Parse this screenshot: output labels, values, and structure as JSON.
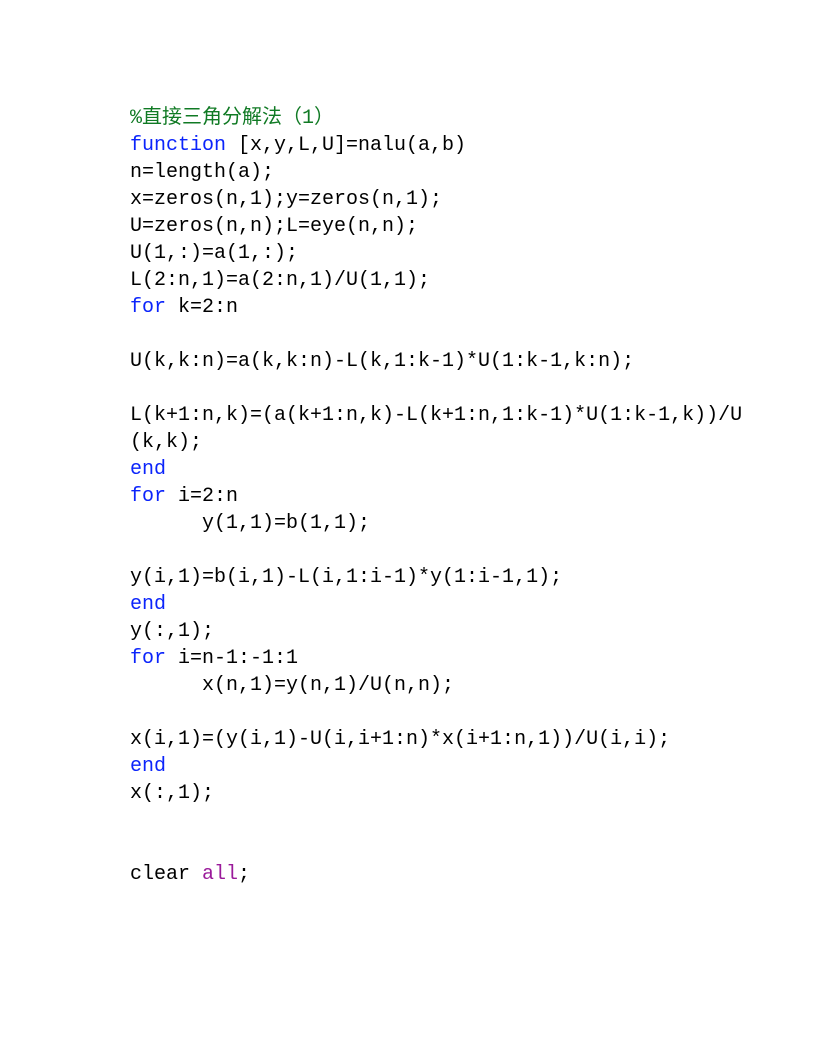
{
  "code": {
    "lines": [
      {
        "segments": [
          {
            "text": "%直接三角分解法（1）",
            "cls": "cmt"
          }
        ]
      },
      {
        "segments": [
          {
            "text": "function",
            "cls": "kw"
          },
          {
            "text": " [x,y,L,U]=nalu(a,b)",
            "cls": "blk"
          }
        ]
      },
      {
        "segments": [
          {
            "text": "n=length(a);",
            "cls": "blk"
          }
        ]
      },
      {
        "segments": [
          {
            "text": "x=zeros(n,1);y=zeros(n,1);",
            "cls": "blk"
          }
        ]
      },
      {
        "segments": [
          {
            "text": "U=zeros(n,n);L=eye(n,n);",
            "cls": "blk"
          }
        ]
      },
      {
        "segments": [
          {
            "text": "U(1,:)=a(1,:);",
            "cls": "blk"
          }
        ]
      },
      {
        "segments": [
          {
            "text": "L(2:n,1)=a(2:n,1)/U(1,1);",
            "cls": "blk"
          }
        ]
      },
      {
        "segments": [
          {
            "text": "for",
            "cls": "kw"
          },
          {
            "text": " k=2:n",
            "cls": "blk"
          }
        ]
      },
      {
        "segments": [
          {
            "text": "",
            "cls": "blk"
          }
        ]
      },
      {
        "segments": [
          {
            "text": "U(k,k:n)=a(k,k:n)-L(k,1:k-1)*U(1:k-1,k:n);",
            "cls": "blk"
          }
        ]
      },
      {
        "segments": [
          {
            "text": "",
            "cls": "blk"
          }
        ]
      },
      {
        "segments": [
          {
            "text": "L(k+1:n,k)=(a(k+1:n,k)-L(k+1:n,1:k-1)*U(1:k-1,k))/U(k,k);",
            "cls": "blk"
          }
        ]
      },
      {
        "segments": [
          {
            "text": "end",
            "cls": "kw"
          }
        ]
      },
      {
        "segments": [
          {
            "text": "for",
            "cls": "kw"
          },
          {
            "text": " i=2:n",
            "cls": "blk"
          }
        ]
      },
      {
        "segments": [
          {
            "text": "      y(1,1)=b(1,1);",
            "cls": "blk"
          }
        ]
      },
      {
        "segments": [
          {
            "text": "",
            "cls": "blk"
          }
        ]
      },
      {
        "segments": [
          {
            "text": "y(i,1)=b(i,1)-L(i,1:i-1)*y(1:i-1,1);",
            "cls": "blk"
          }
        ]
      },
      {
        "segments": [
          {
            "text": "end",
            "cls": "kw"
          }
        ]
      },
      {
        "segments": [
          {
            "text": "y(:,1);",
            "cls": "blk"
          }
        ]
      },
      {
        "segments": [
          {
            "text": "for",
            "cls": "kw"
          },
          {
            "text": " i=n-1:-1:1",
            "cls": "blk"
          }
        ]
      },
      {
        "segments": [
          {
            "text": "      x(n,1)=y(n,1)/U(n,n);",
            "cls": "blk"
          }
        ]
      },
      {
        "segments": [
          {
            "text": "",
            "cls": "blk"
          }
        ]
      },
      {
        "segments": [
          {
            "text": "x(i,1)=(y(i,1)-U(i,i+1:n)*x(i+1:n,1))/U(i,i);",
            "cls": "blk"
          }
        ]
      },
      {
        "segments": [
          {
            "text": "end",
            "cls": "kw"
          }
        ]
      },
      {
        "segments": [
          {
            "text": "x(:,1);",
            "cls": "blk"
          }
        ]
      },
      {
        "segments": [
          {
            "text": "",
            "cls": "blk"
          }
        ]
      },
      {
        "segments": [
          {
            "text": "",
            "cls": "blk"
          }
        ]
      },
      {
        "segments": [
          {
            "text": "clear ",
            "cls": "blk"
          },
          {
            "text": "all",
            "cls": "str"
          },
          {
            "text": ";",
            "cls": "blk"
          }
        ]
      }
    ]
  }
}
